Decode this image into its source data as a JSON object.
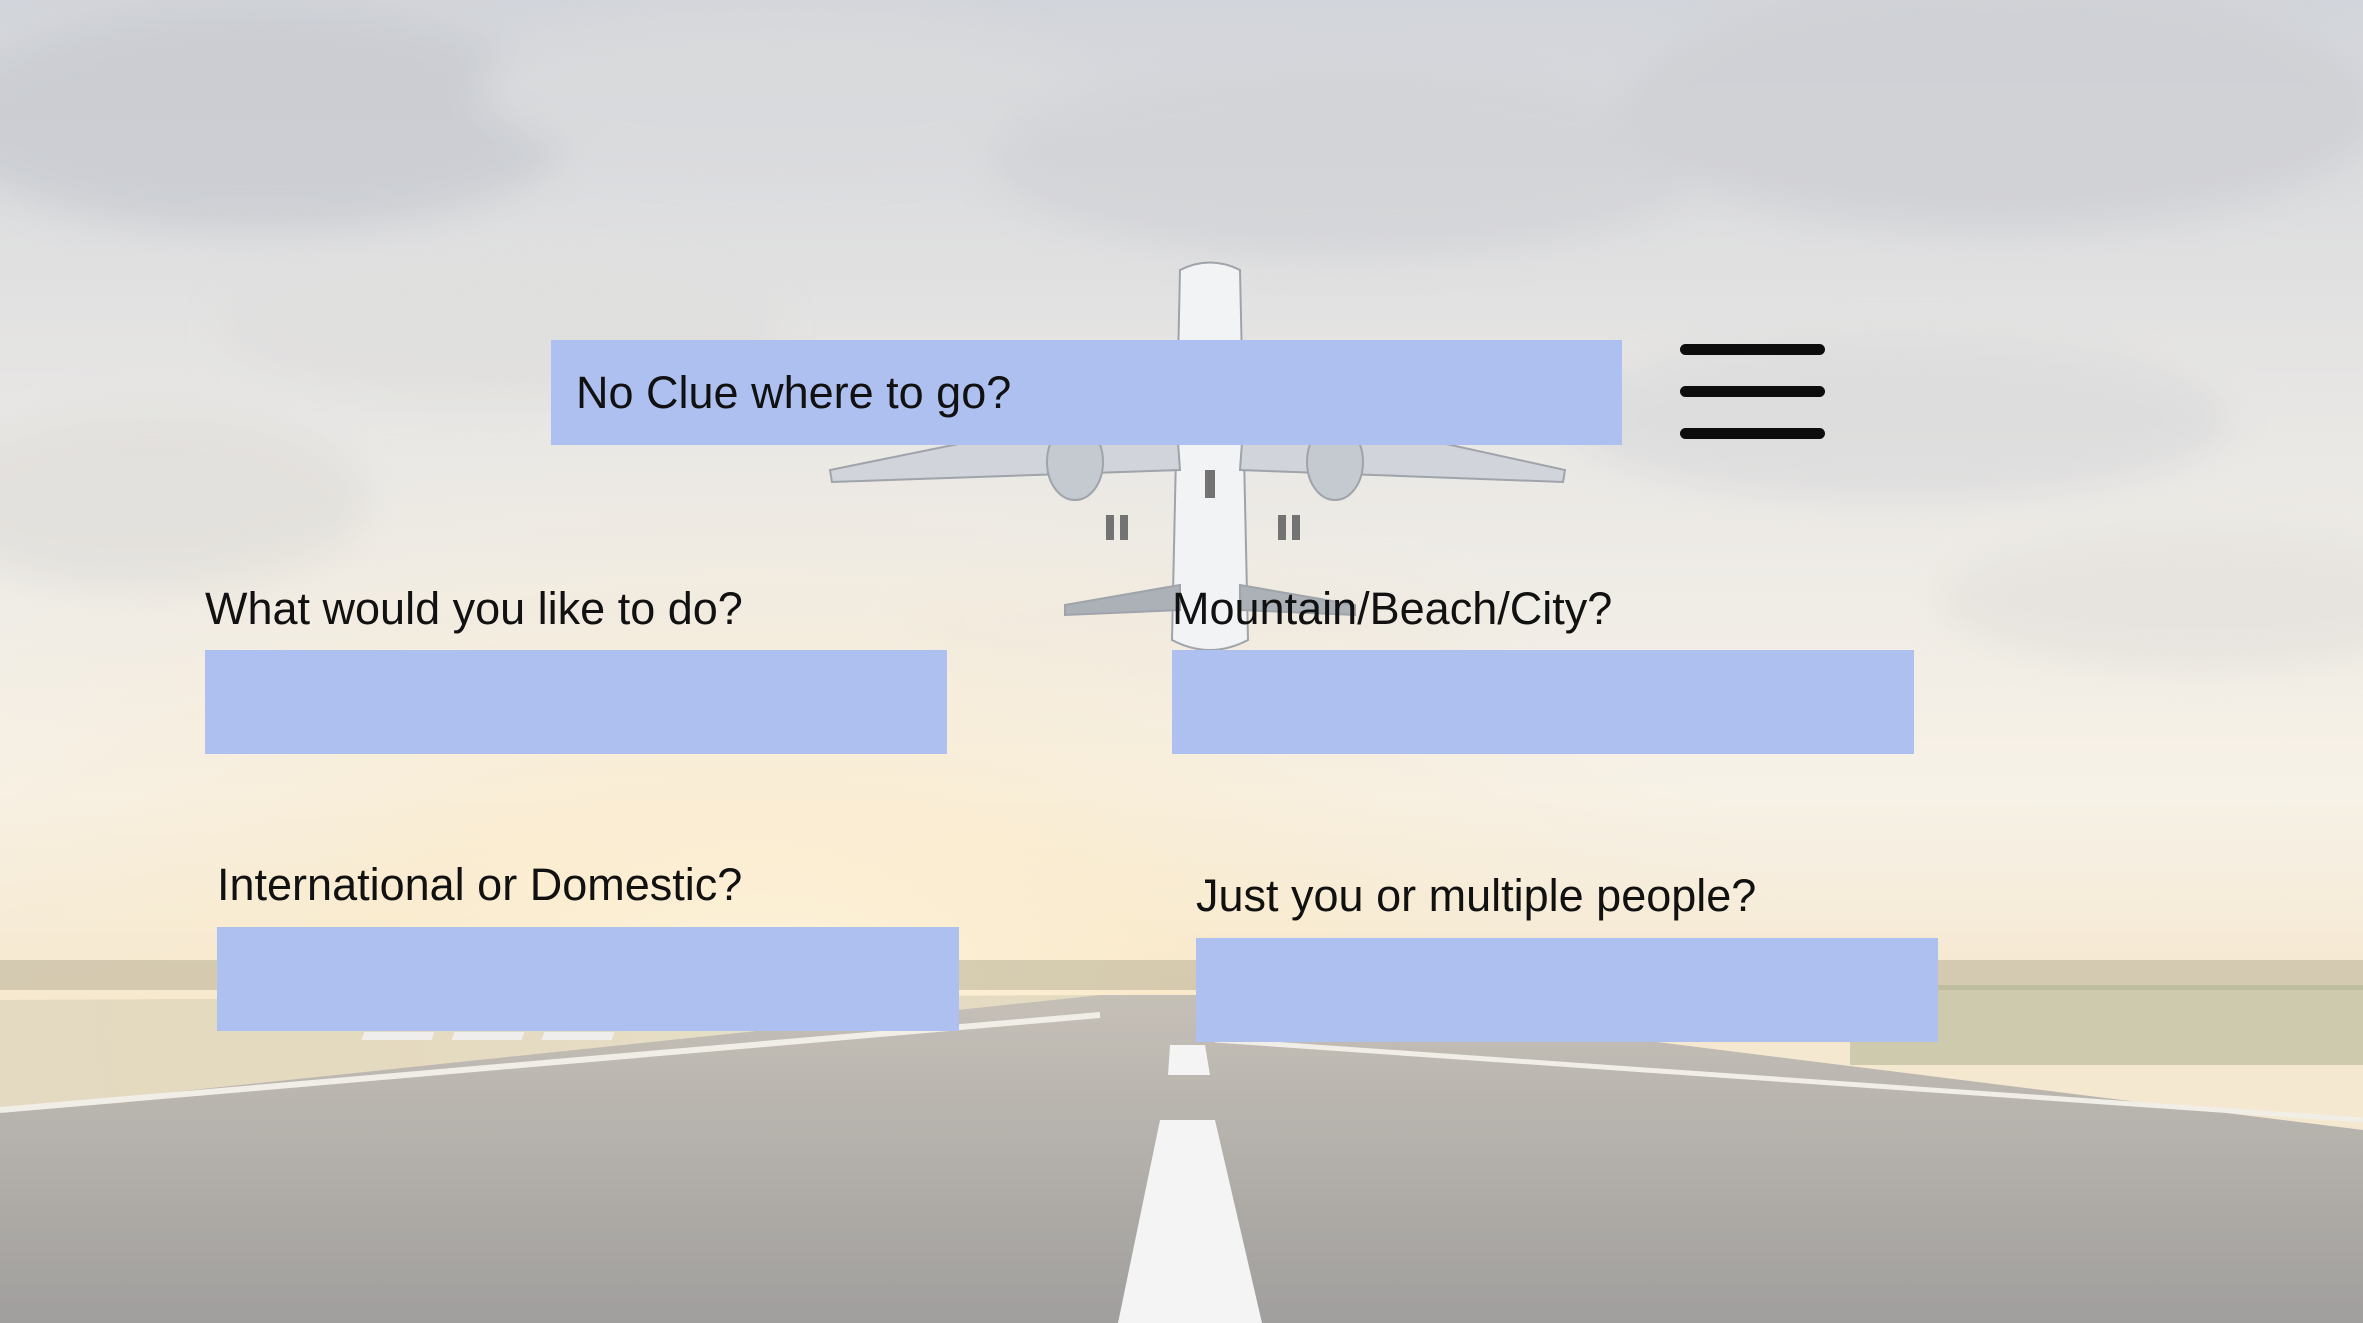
{
  "header": {
    "title": "No Clue where to go?",
    "menu_icon": "hamburger-menu-icon"
  },
  "form": {
    "activity": {
      "label": "What would you like to do?",
      "value": ""
    },
    "terrain": {
      "label": "Mountain/Beach/City?",
      "value": ""
    },
    "scope": {
      "label": "International or Domestic?",
      "value": ""
    },
    "party": {
      "label": "Just you or multiple people?",
      "value": ""
    }
  },
  "colors": {
    "field_fill": "#adc0ef",
    "text": "#111111"
  },
  "background": {
    "scene": "airplane taking off over runway at sunrise"
  }
}
